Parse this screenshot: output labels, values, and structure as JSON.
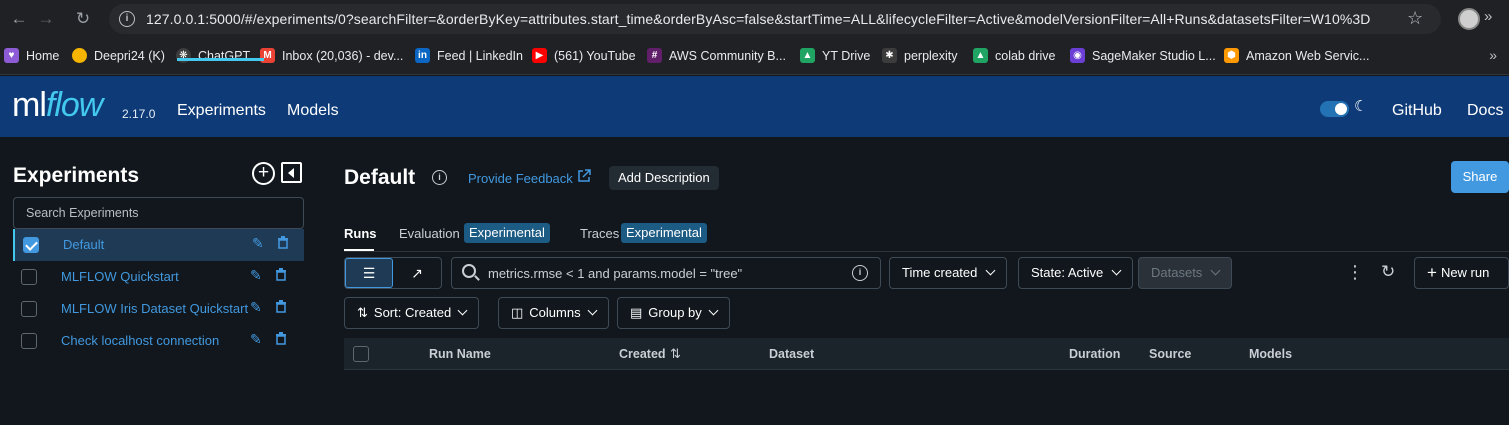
{
  "browser": {
    "url": "127.0.0.1:5000/#/experiments/0?searchFilter=&orderByKey=attributes.start_time&orderByAsc=false&startTime=ALL&lifecycleFilter=Active&modelVersionFilter=All+Runs&datasetsFilter=W10%3D",
    "bookmarks": [
      {
        "label": "Home",
        "icon": "home-icon",
        "color": "#8e5bd6"
      },
      {
        "label": "Deepri24 (K)",
        "icon": "emoji-icon",
        "color": "#f4b400"
      },
      {
        "label": "ChatGPT",
        "icon": "chatgpt-icon",
        "color": "#3c3c3c"
      },
      {
        "label": "Inbox (20,036) - dev...",
        "icon": "gmail-icon",
        "color": "#ea4335"
      },
      {
        "label": "Feed | LinkedIn",
        "icon": "linkedin-icon",
        "color": "#0a66c2"
      },
      {
        "label": "(561) YouTube",
        "icon": "youtube-icon",
        "color": "#ff0000"
      },
      {
        "label": "AWS Community B...",
        "icon": "slack-icon",
        "color": "#611f69"
      },
      {
        "label": "YT Drive",
        "icon": "drive-icon",
        "color": "#1fa463"
      },
      {
        "label": "perplexity",
        "icon": "perplexity-icon",
        "color": "#3c3c3c"
      },
      {
        "label": "colab drive",
        "icon": "drive-icon",
        "color": "#1fa463"
      },
      {
        "label": "SageMaker Studio L...",
        "icon": "sagemaker-icon",
        "color": "#6b3fd6"
      },
      {
        "label": "Amazon Web Servic...",
        "icon": "aws-icon",
        "color": "#ff9900"
      }
    ]
  },
  "header": {
    "logo_ml": "ml",
    "logo_flow": "flow",
    "version": "2.17.0",
    "nav": [
      "Experiments",
      "Models"
    ],
    "links": [
      "GitHub",
      "Docs"
    ]
  },
  "sidebar": {
    "title": "Experiments",
    "search_placeholder": "Search Experiments",
    "experiments": [
      {
        "name": "Default",
        "checked": true
      },
      {
        "name": "MLFLOW Quickstart",
        "checked": false
      },
      {
        "name": "MLFLOW Iris Dataset Quickstart",
        "checked": false
      },
      {
        "name": "Check localhost connection",
        "checked": false
      }
    ]
  },
  "main": {
    "title": "Default",
    "feedback": "Provide Feedback",
    "add_description": "Add Description",
    "share": "Share",
    "tabs": {
      "runs": "Runs",
      "evaluation": "Evaluation",
      "evaluation_badge": "Experimental",
      "traces": "Traces",
      "traces_badge": "Experimental"
    },
    "filter_text": "metrics.rmse < 1 and params.model = \"tree\"",
    "time_created": "Time created",
    "state": "State: Active",
    "datasets": "Datasets",
    "new_run": "New run",
    "sort": "Sort: Created",
    "columns": "Columns",
    "group_by": "Group by",
    "table_headers": {
      "run_name": "Run Name",
      "created": "Created",
      "dataset": "Dataset",
      "duration": "Duration",
      "source": "Source",
      "models": "Models"
    }
  }
}
